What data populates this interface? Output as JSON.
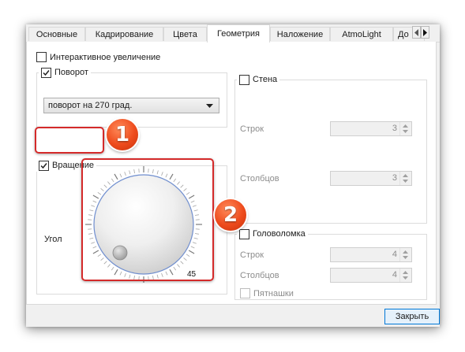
{
  "tabs": [
    {
      "label": "Основные"
    },
    {
      "label": "Кадрирование"
    },
    {
      "label": "Цвета"
    },
    {
      "label": "Геометрия"
    },
    {
      "label": "Наложение"
    },
    {
      "label": "AtmoLight"
    },
    {
      "label": "До"
    }
  ],
  "active_tab": "Геометрия",
  "left": {
    "interactive_zoom": {
      "label": "Интерактивное увеличение",
      "checked": false
    },
    "rotate": {
      "label": "Поворот",
      "checked": true,
      "select_value": "поворот на 270 град."
    },
    "rotation": {
      "label": "Вращение",
      "checked": true,
      "angle_label": "Угол",
      "dial_value": "45"
    }
  },
  "right": {
    "wall": {
      "label": "Стена",
      "checked": false,
      "rows_label": "Строк",
      "rows_value": "3",
      "cols_label": "Столбцов",
      "cols_value": "3"
    },
    "puzzle": {
      "label": "Головоломка",
      "checked": false,
      "rows_label": "Строк",
      "rows_value": "4",
      "cols_label": "Столбцов",
      "cols_value": "4",
      "fifteen_label": "Пятнашки",
      "fifteen_checked": false
    }
  },
  "annotations": {
    "badge1": "1",
    "badge2": "2",
    "highlight_color": "#d42a2a"
  },
  "footer": {
    "close_label": "Закрыть"
  }
}
